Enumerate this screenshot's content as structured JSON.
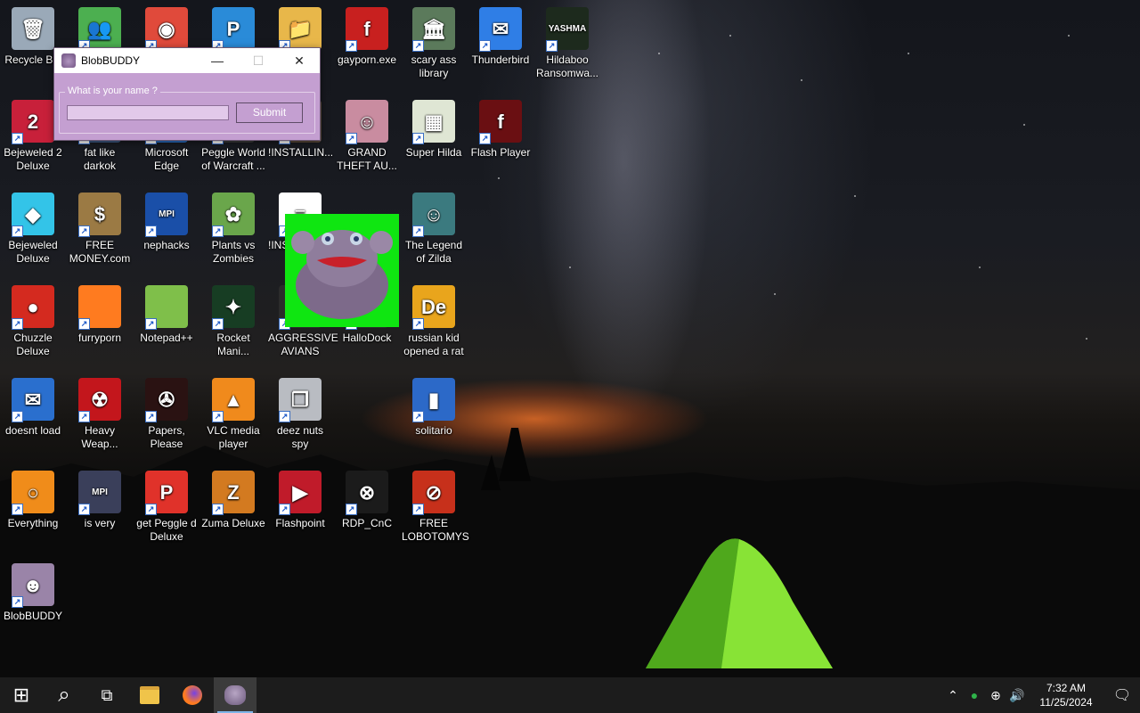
{
  "desktop": {
    "icons": [
      {
        "label": "Recycle Bin",
        "icon": "recycle-bin-icon",
        "color": "#9aa9b8",
        "glyph": "🗑"
      },
      {
        "label": "",
        "icon": "messenger-icon",
        "color": "#4caf50",
        "glyph": "👥"
      },
      {
        "label": "",
        "icon": "chrome-icon",
        "color": "#e04a3b",
        "glyph": "◉"
      },
      {
        "label": "",
        "icon": "peggle-icon",
        "color": "#2a8bd8",
        "glyph": "P"
      },
      {
        "label": "",
        "icon": "folder-icon",
        "color": "#e8b74a",
        "glyph": "📁"
      },
      {
        "label": "gayporn.exe",
        "icon": "flash-icon",
        "color": "#c8201f",
        "glyph": "f"
      },
      {
        "label": "scary ass library",
        "icon": "library-icon",
        "color": "#5b7a5b",
        "glyph": "🏛"
      },
      {
        "label": "Thunderbird",
        "icon": "thunderbird-icon",
        "color": "#2f7ee6",
        "glyph": "✉"
      },
      {
        "label": "Hildaboo Ransomwa...",
        "icon": "ransomware-icon",
        "color": "#1d2a1d",
        "glyph": "YASHMA"
      },
      {
        "label": "Bejeweled 2 Deluxe",
        "icon": "bejeweled2-icon",
        "color": "#c8203a",
        "glyph": "2"
      },
      {
        "label": "fat like darkok",
        "icon": "generic-app-icon",
        "color": "#3e5a84",
        "glyph": ""
      },
      {
        "label": "Microsoft Edge",
        "icon": "edge-icon",
        "color": "#2a6ec4",
        "glyph": ""
      },
      {
        "label": "Peggle World of Warcraft ...",
        "icon": "peggle-wow-icon",
        "color": "#3b3b3b",
        "glyph": ""
      },
      {
        "label": "!INSTALLIN...",
        "icon": "installer-icon",
        "color": "#5b4a3a",
        "glyph": ""
      },
      {
        "label": "GRAND THEFT AU...",
        "icon": "anime-girl-icon",
        "color": "#c98ca0",
        "glyph": "☺"
      },
      {
        "label": "Super Hilda",
        "icon": "super-hilda-icon",
        "color": "#dfe6d4",
        "glyph": "▦"
      },
      {
        "label": "Flash Player",
        "icon": "flash-player-icon",
        "color": "#6a0f12",
        "glyph": "f"
      },
      {
        "label": "Bejeweled Deluxe",
        "icon": "diamond-icon",
        "color": "#33c4e8",
        "glyph": "◆"
      },
      {
        "label": "FREE MONEY.com",
        "icon": "money-bag-icon",
        "color": "#9b7a44",
        "glyph": "$"
      },
      {
        "label": "nephacks",
        "icon": "mpi-icon",
        "color": "#1a4fa8",
        "glyph": "MPI"
      },
      {
        "label": "Plants vs Zombies",
        "icon": "plants-vs-zombies-icon",
        "color": "#6aa64b",
        "glyph": "✿"
      },
      {
        "label": "!INSTALLIN... - S...",
        "icon": "document-icon",
        "color": "#ffffff",
        "glyph": "≡"
      },
      {
        "label": "The Legend of Zilda",
        "icon": "zilda-icon",
        "color": "#3b7a7f",
        "glyph": "☺"
      },
      {
        "label": "Chuzzle Deluxe",
        "icon": "chuzzle-icon",
        "color": "#d42a1f",
        "glyph": "●"
      },
      {
        "label": "furryporn",
        "icon": "firefox-icon",
        "color": "#ff7b1f",
        "glyph": ""
      },
      {
        "label": "Notepad++",
        "icon": "notepadpp-icon",
        "color": "#7fbf4a",
        "glyph": ""
      },
      {
        "label": "Rocket Mani...",
        "icon": "rocket-mania-icon",
        "color": "#173d23",
        "glyph": "✦"
      },
      {
        "label": "AGGRESSIVE AVIANS",
        "icon": "angry-birds-icon",
        "color": "#2b2b2b",
        "glyph": ""
      },
      {
        "label": "HalloDock",
        "icon": "hallodock-icon",
        "color": "#2b2b2b",
        "glyph": ""
      },
      {
        "label": "russian kid opened a rat",
        "icon": "de-icon",
        "color": "#e9a51c",
        "glyph": "De"
      },
      {
        "label": "doesnt load",
        "icon": "thunderbird-old-icon",
        "color": "#2a6fce",
        "glyph": "✉"
      },
      {
        "label": "Heavy Weap...",
        "icon": "radiation-icon",
        "color": "#c3161c",
        "glyph": "☢"
      },
      {
        "label": "Papers, Please",
        "icon": "papers-please-icon",
        "color": "#2a1212",
        "glyph": "✇"
      },
      {
        "label": "VLC media player",
        "icon": "vlc-icon",
        "color": "#f08a1c",
        "glyph": "▲"
      },
      {
        "label": "deez nuts spy",
        "icon": "copy-windows-icon",
        "color": "#b9bcc2",
        "glyph": "❐"
      },
      {
        "label": "solitario",
        "icon": "solitario-icon",
        "color": "#2c69c8",
        "glyph": "▮"
      },
      {
        "label": "Everything",
        "icon": "everything-search-icon",
        "color": "#f08c1a",
        "glyph": "○"
      },
      {
        "label": "is very",
        "icon": "mpi-shield-icon",
        "color": "#3a3f5a",
        "glyph": "MPI"
      },
      {
        "label": "get Peggle d Deluxe",
        "icon": "peggle-deluxe-icon",
        "color": "#e0322a",
        "glyph": "P"
      },
      {
        "label": "Zuma Deluxe",
        "icon": "zuma-icon",
        "color": "#d37a20",
        "glyph": "Z"
      },
      {
        "label": "Flashpoint",
        "icon": "flashpoint-icon",
        "color": "#c01b2a",
        "glyph": "▶"
      },
      {
        "label": "RDP_CnC",
        "icon": "rdp-icon",
        "color": "#1b1b1b",
        "glyph": "⊗"
      },
      {
        "label": "FREE LOBOTOMYS",
        "icon": "lobotomy-icon",
        "color": "#c7301b",
        "glyph": "⊘"
      },
      {
        "label": "BlobBUDDY",
        "icon": "blobbuddy-icon",
        "color": "#9a84a8",
        "glyph": "☻"
      }
    ]
  },
  "dialog": {
    "title": "BlobBUDDY",
    "group_label": "What is your name ?",
    "input_value": "",
    "submit_label": "Submit",
    "minimize": "—",
    "maximize": "☐",
    "close": "✕"
  },
  "taskbar": {
    "start": "⊞",
    "search": "⌕",
    "task_view": "⧉",
    "clock_time": "7:32 AM",
    "clock_date": "11/25/2024",
    "tray_chevron": "⌃",
    "tray_network": "⊕",
    "tray_volume": "🔊",
    "tray_notifications": "🗨"
  },
  "colors": {
    "dialog_bg": "#c49fd1",
    "taskbar_bg": "#1c1c1c",
    "halldock_bg": "#0fe611"
  }
}
